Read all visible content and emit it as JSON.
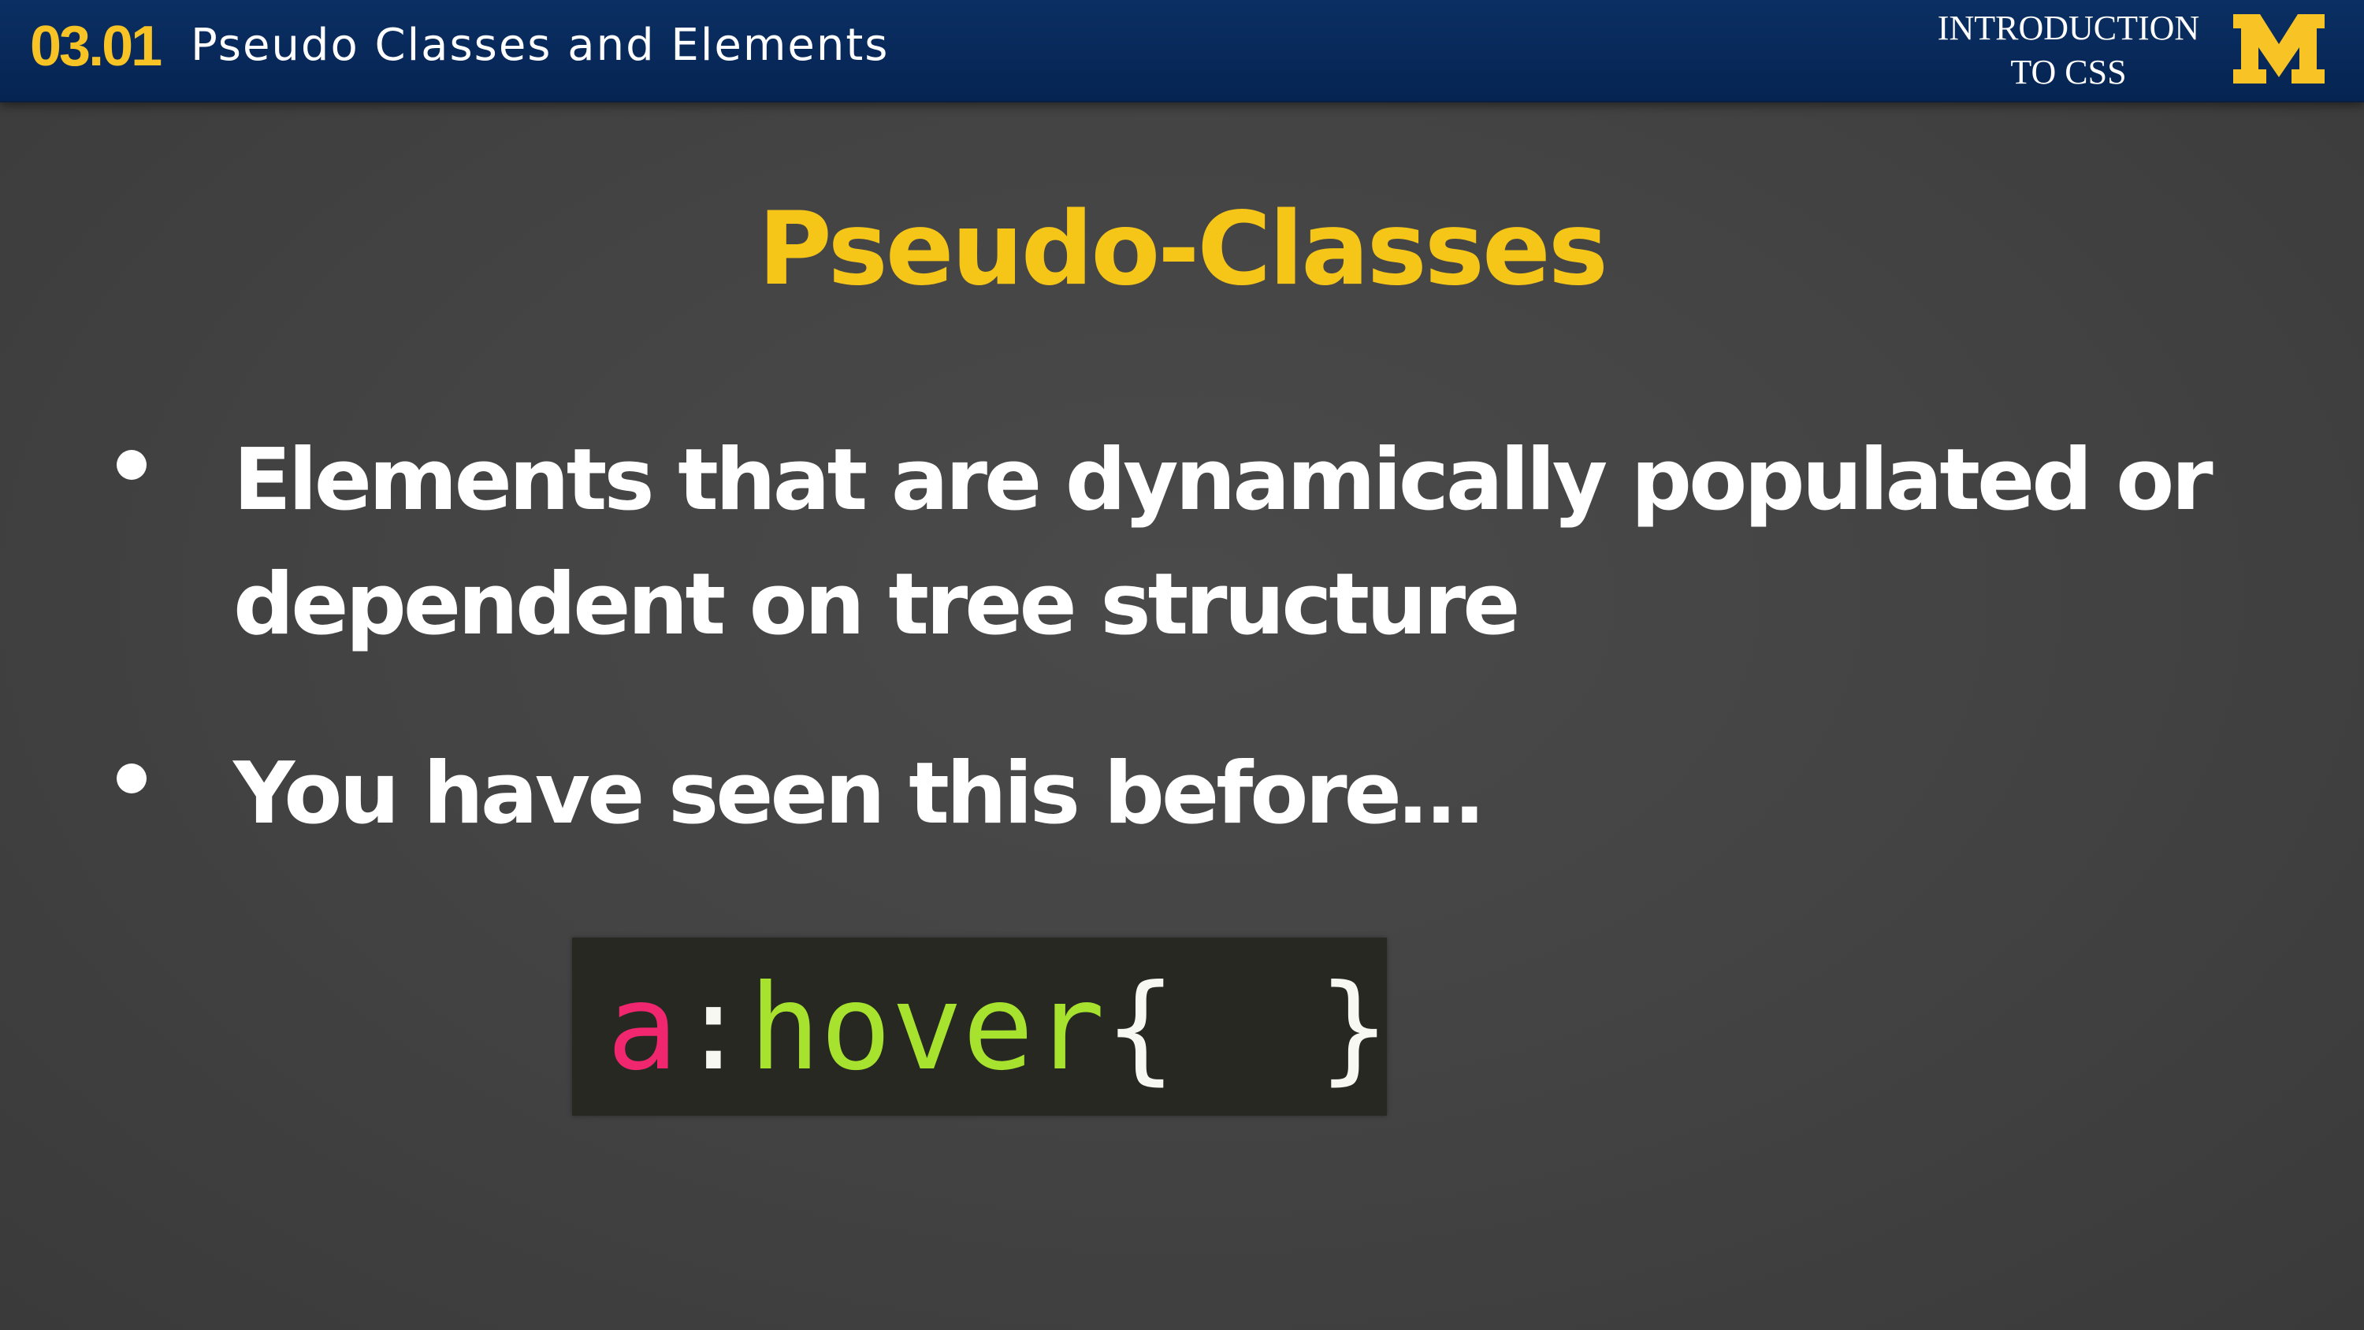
{
  "header": {
    "lesson_number": "03.01",
    "lesson_title": "Pseudo Classes and Elements",
    "course_name": "INTRODUCTION\nTO CSS",
    "logo_icon": "block-m-icon",
    "colors": {
      "bar": "#052452",
      "accent": "#f7c325"
    }
  },
  "slide": {
    "title": "Pseudo-Classes",
    "bullets": [
      {
        "text": "Elements that are dynamically populated or dependent on tree structure"
      },
      {
        "text": "You have seen this before…"
      }
    ],
    "code": {
      "selector": "a",
      "colon": ":",
      "pseudo": "hover",
      "open_brace": "{",
      "gap": "  ",
      "close_brace": "}",
      "colors": {
        "background": "#272822",
        "selector": "#f0266f",
        "pseudo": "#a6e22e",
        "punctuation": "#f8f8f2"
      }
    },
    "colors": {
      "background": "#444444",
      "title": "#f5c518",
      "text": "#ffffff"
    }
  }
}
